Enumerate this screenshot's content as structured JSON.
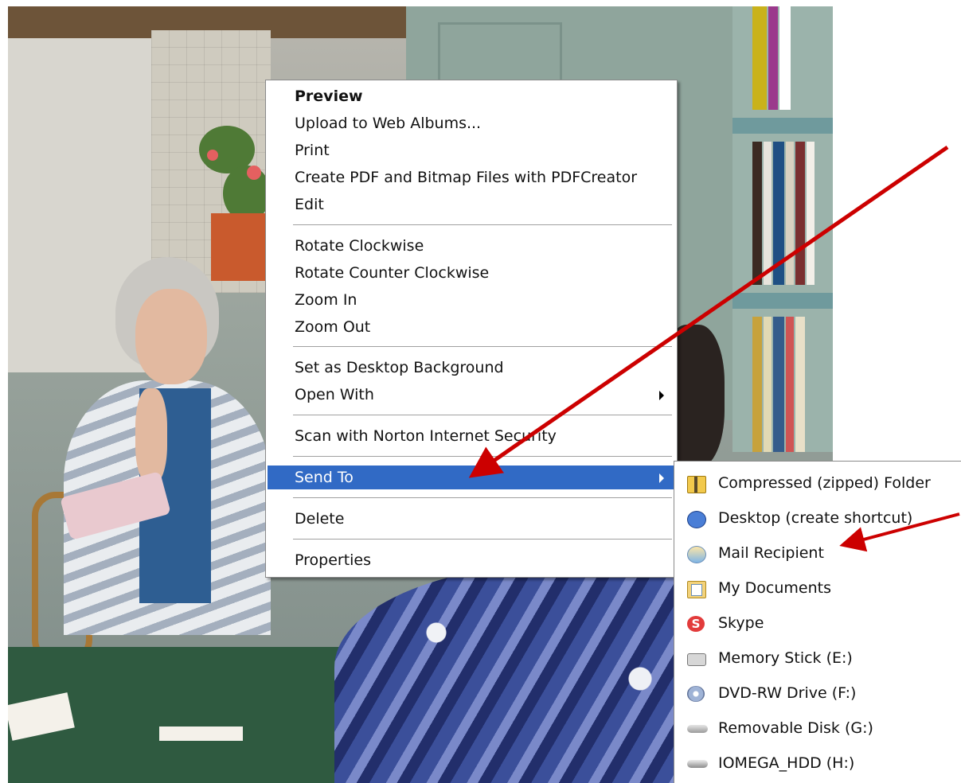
{
  "context_menu": {
    "items": [
      {
        "label": "Preview",
        "bold": true
      },
      {
        "label": "Upload to Web Albums..."
      },
      {
        "label": "Print"
      },
      {
        "label": "Create PDF and Bitmap Files with PDFCreator"
      },
      {
        "label": "Edit"
      },
      {
        "label": "Rotate Clockwise"
      },
      {
        "label": "Rotate Counter Clockwise"
      },
      {
        "label": "Zoom In"
      },
      {
        "label": "Zoom Out"
      },
      {
        "label": "Set as Desktop Background"
      },
      {
        "label": "Open With",
        "has_submenu": true
      },
      {
        "label": "Scan with Norton Internet Security"
      },
      {
        "label": "Send To",
        "has_submenu": true,
        "selected": true
      },
      {
        "label": "Delete"
      },
      {
        "label": "Properties"
      }
    ],
    "selected_color": "#316ac5"
  },
  "send_to_submenu": {
    "items": [
      {
        "label": "Compressed (zipped) Folder",
        "icon": "zip-folder-icon"
      },
      {
        "label": "Desktop (create shortcut)",
        "icon": "desktop-shortcut-icon"
      },
      {
        "label": "Mail Recipient",
        "icon": "mail-recipient-icon"
      },
      {
        "label": "My Documents",
        "icon": "my-documents-icon"
      },
      {
        "label": "Skype",
        "icon": "skype-icon",
        "glyph": "S"
      },
      {
        "label": "Memory Stick (E:)",
        "icon": "memory-stick-icon"
      },
      {
        "label": "DVD-RW Drive (F:)",
        "icon": "dvd-drive-icon"
      },
      {
        "label": "Removable Disk (G:)",
        "icon": "removable-disk-icon"
      },
      {
        "label": "IOMEGA_HDD (H:)",
        "icon": "hard-drive-icon"
      }
    ]
  },
  "annotations": {
    "arrow_color": "#cc0000"
  }
}
